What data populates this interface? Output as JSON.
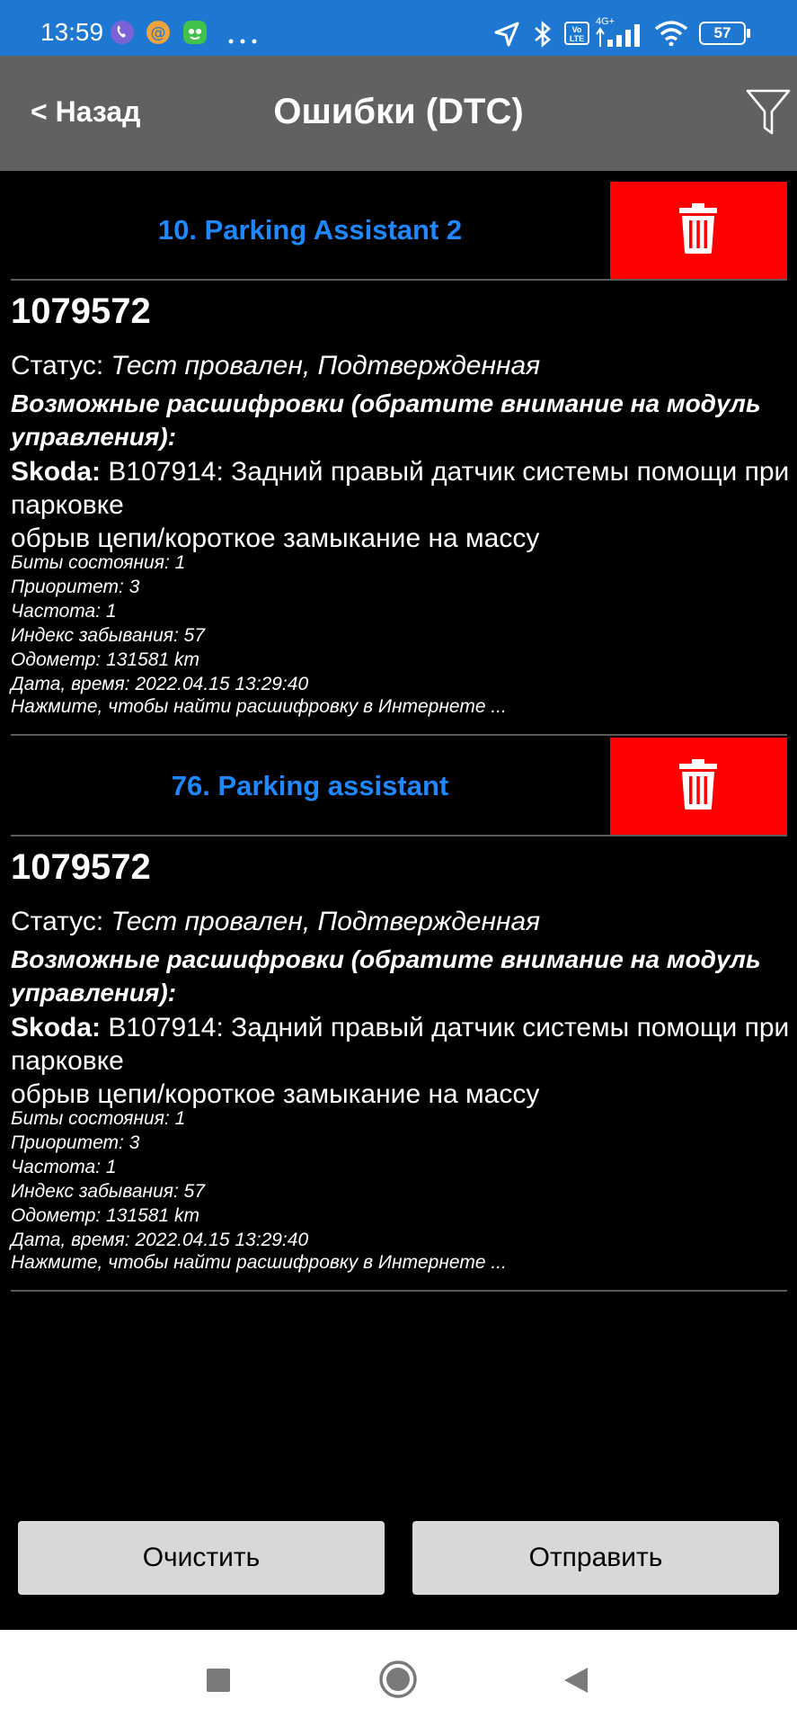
{
  "status_bar": {
    "time": "13:59",
    "lte_label": "Vo LTE",
    "network_label": "4G+",
    "battery": "57"
  },
  "header": {
    "back_label": "< Назад",
    "title": "Ошибки (DTC)"
  },
  "errors": [
    {
      "module": "10. Parking Assistant 2",
      "code": "1079572",
      "status_label": "Статус:",
      "status_value": "Тест провален, Подтвержденная",
      "hint_heading": "Возможные расшифровки (обратите внимание на модуль управления):",
      "brand": "Skoda:",
      "decode_line1": "B107914: Задний правый датчик системы помощи при парковке",
      "decode_line2": "обрыв цепи/короткое замыкание на массу",
      "details": [
        "Биты состояния: 1",
        "Приоритет: 3",
        "Частота: 1",
        "Индекс забывания: 57",
        "Одометр: 131581 km",
        "Дата, время: 2022.04.15 13:29:40"
      ],
      "search_link": "Нажмите, чтобы найти расшифровку в Интернете ..."
    },
    {
      "module": "76. Parking assistant",
      "code": "1079572",
      "status_label": "Статус:",
      "status_value": "Тест провален, Подтвержденная",
      "hint_heading": "Возможные расшифровки (обратите внимание на модуль управления):",
      "brand": "Skoda:",
      "decode_line1": "B107914: Задний правый датчик системы помощи при парковке",
      "decode_line2": "обрыв цепи/короткое замыкание на массу",
      "details": [
        "Биты состояния: 1",
        "Приоритет: 3",
        "Частота: 1",
        "Индекс забывания: 57",
        "Одометр: 131581 km",
        "Дата, время: 2022.04.15 13:29:40"
      ],
      "search_link": "Нажмите, чтобы найти расшифровку в Интернете ..."
    }
  ],
  "buttons": {
    "clear_label": "Очистить",
    "send_label": "Отправить"
  },
  "colors": {
    "status_bar": "#1e78d2",
    "header": "#616161",
    "module_title": "#1e88ff",
    "delete_button": "#ff0000",
    "button_bg": "#d8d8d8"
  },
  "icons": [
    "viber-icon",
    "mail-icon",
    "app-icon",
    "more-dots-icon",
    "location-icon",
    "bluetooth-icon",
    "signal-icon",
    "wifi-icon",
    "battery-icon",
    "filter-icon",
    "trash-icon",
    "nav-recents-icon",
    "nav-home-icon",
    "nav-back-icon"
  ]
}
